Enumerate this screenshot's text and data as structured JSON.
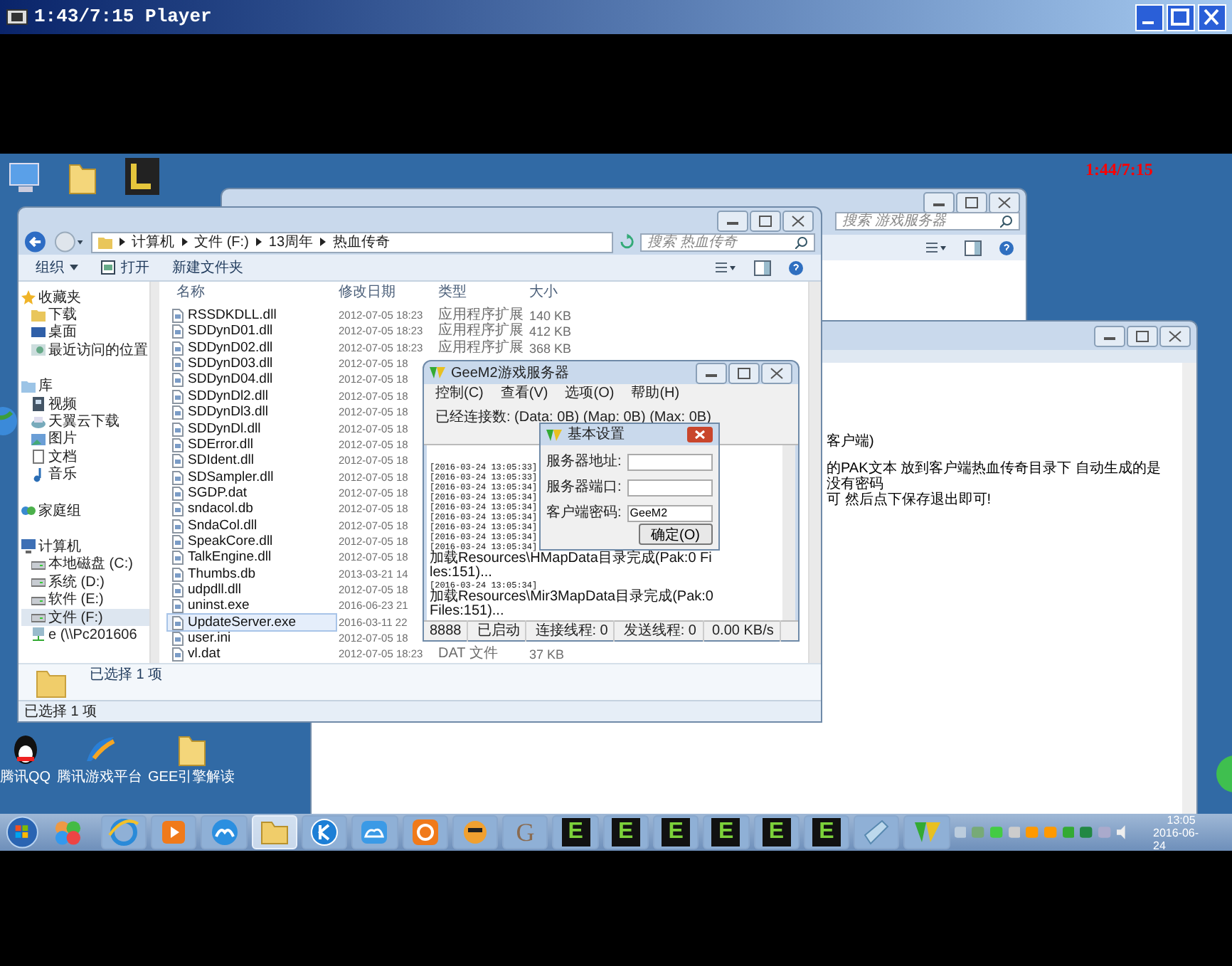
{
  "player": {
    "title": "1:43/7:15 Player"
  },
  "recording_time": "1:44/7:15",
  "desktop_icons": [
    {
      "label": "腾讯QQ"
    },
    {
      "label": "腾讯游戏平台"
    },
    {
      "label": "GEE引擎解读"
    }
  ],
  "back_window": {
    "search_placeholder": "搜索 游戏服务器"
  },
  "notepad": {
    "lines": [
      "客户端)",
      "的PAK文本 放到客户端热血传奇目录下   自动生成的是没有密码",
      "可 然后点下保存退出即可!"
    ]
  },
  "explorer": {
    "breadcrumb": [
      "计算机",
      "文件 (F:)",
      "13周年",
      "热血传奇"
    ],
    "search_placeholder": "搜索 热血传奇",
    "toolbar": [
      "组织",
      "打开",
      "新建文件夹"
    ],
    "sidebar": [
      {
        "label": "收藏夹",
        "kind": "star",
        "selected": false,
        "children": [
          {
            "label": "下载",
            "kind": "folder",
            "selected": false
          },
          {
            "label": "桌面",
            "kind": "desktop",
            "selected": false
          },
          {
            "label": "最近访问的位置",
            "kind": "recent",
            "selected": false
          }
        ]
      },
      {
        "label": "库",
        "kind": "library",
        "selected": false,
        "children": [
          {
            "label": "视频",
            "kind": "video",
            "selected": false
          },
          {
            "label": "天翼云下载",
            "kind": "cloud",
            "selected": false
          },
          {
            "label": "图片",
            "kind": "picture",
            "selected": false
          },
          {
            "label": "文档",
            "kind": "document",
            "selected": false
          },
          {
            "label": "音乐",
            "kind": "music",
            "selected": false
          }
        ]
      },
      {
        "label": "家庭组",
        "kind": "homegroup",
        "selected": false
      },
      {
        "label": "计算机",
        "kind": "computer",
        "selected": false,
        "children": [
          {
            "label": "本地磁盘 (C:)",
            "kind": "drive",
            "selected": false
          },
          {
            "label": "系统 (D:)",
            "kind": "drive",
            "selected": false
          },
          {
            "label": "软件 (E:)",
            "kind": "drive",
            "selected": false
          },
          {
            "label": "文件 (F:)",
            "kind": "drive",
            "selected": true
          },
          {
            "label": "e (\\\\Pc201606",
            "kind": "network",
            "selected": false
          }
        ]
      }
    ],
    "columns": [
      "名称",
      "修改日期",
      "类型",
      "大小"
    ],
    "rows": [
      {
        "name": "RSSDKDLL.dll",
        "date": "2012-07-05 18:23",
        "type": "应用程序扩展",
        "size": "140 KB",
        "selected": false
      },
      {
        "name": "SDDynD01.dll",
        "date": "2012-07-05 18:23",
        "type": "应用程序扩展",
        "size": "412 KB",
        "selected": false
      },
      {
        "name": "SDDynD02.dll",
        "date": "2012-07-05 18:23",
        "type": "应用程序扩展",
        "size": "368 KB",
        "selected": false
      },
      {
        "name": "SDDynD03.dll",
        "date": "2012-07-05 18",
        "selected": false
      },
      {
        "name": "SDDynD04.dll",
        "date": "2012-07-05 18",
        "selected": false
      },
      {
        "name": "SDDynDl2.dll",
        "date": "2012-07-05 18",
        "selected": false
      },
      {
        "name": "SDDynDl3.dll",
        "date": "2012-07-05 18",
        "selected": false
      },
      {
        "name": "SDDynDl.dll",
        "date": "2012-07-05 18",
        "selected": false
      },
      {
        "name": "SDError.dll",
        "date": "2012-07-05 18",
        "selected": false
      },
      {
        "name": "SDIdent.dll",
        "date": "2012-07-05 18",
        "selected": false
      },
      {
        "name": "SDSampler.dll",
        "date": "2012-07-05 18",
        "selected": false
      },
      {
        "name": "SGDP.dat",
        "date": "2012-07-05 18",
        "selected": false
      },
      {
        "name": "sndacol.db",
        "date": "2012-07-05 18",
        "selected": false
      },
      {
        "name": "SndaCol.dll",
        "date": "2012-07-05 18",
        "selected": false
      },
      {
        "name": "SpeakCore.dll",
        "date": "2012-07-05 18",
        "selected": false
      },
      {
        "name": "TalkEngine.dll",
        "date": "2012-07-05 18",
        "selected": false
      },
      {
        "name": "Thumbs.db",
        "date": "2013-03-21 14",
        "selected": false
      },
      {
        "name": "udpdll.dll",
        "date": "2012-07-05 18",
        "selected": false
      },
      {
        "name": "uninst.exe",
        "date": "2016-06-23 21",
        "selected": false
      },
      {
        "name": "UpdateServer.exe",
        "date": "2016-03-11 22",
        "selected": true
      },
      {
        "name": "user.ini",
        "date": "2012-07-05 18",
        "selected": false
      },
      {
        "name": "vl.dat",
        "date": "2012-07-05 18:23",
        "type": "DAT 文件",
        "size": "37 KB",
        "selected": false
      }
    ],
    "details": "已选择 1 项",
    "status": "已选择 1 项"
  },
  "server": {
    "title": "GeeM2游戏服务器",
    "menu": [
      "控制(C)",
      "查看(V)",
      "选项(O)",
      "帮助(H)"
    ],
    "info": "已经连接数: (Data: 0B) (Map: 0B) (Max: 0B)",
    "log": [
      {
        "time": "[2016-03-24 13:05:33]"
      },
      {
        "time": "[2016-03-24 13:05:33]"
      },
      {
        "time": "[2016-03-24 13:05:34]"
      },
      {
        "time": "[2016-03-24 13:05:34]"
      },
      {
        "time": "[2016-03-24 13:05:34]"
      },
      {
        "time": "[2016-03-24 13:05:34]"
      },
      {
        "time": "[2016-03-24 13:05:34]"
      },
      {
        "time": "[2016-03-24 13:05:34]"
      },
      {
        "time": "[2016-03-24 13:05:34]",
        "message": "加载Resources\\HMapData目录完成(Pak:0 Files:151)..."
      },
      {
        "time": "[2016-03-24 13:05:34]",
        "message": "加载Resources\\Mir3MapData目录完成(Pak:0 Files:151)..."
      }
    ],
    "status": [
      "8888",
      "已启动",
      "连接线程: 0",
      "发送线程: 0",
      "0.00 KB/s"
    ],
    "dialog": {
      "title": "基本设置",
      "fields": [
        {
          "label": "服务器地址:"
        },
        {
          "label": "服务器端口:"
        },
        {
          "label": "客户端密码:",
          "value": "GeeM2"
        }
      ],
      "button": "确定(O)"
    }
  },
  "taskbar": {
    "items": [
      {
        "kind": "ie"
      },
      {
        "kind": "player"
      },
      {
        "kind": "cloud"
      },
      {
        "kind": "folder",
        "selected": true
      },
      {
        "kind": "k"
      },
      {
        "kind": "cloud2"
      },
      {
        "kind": "browser"
      },
      {
        "kind": "game"
      },
      {
        "kind": "letter",
        "text": "G"
      },
      {
        "kind": "e",
        "text": "E"
      },
      {
        "kind": "e",
        "text": "E"
      },
      {
        "kind": "e",
        "text": "E"
      },
      {
        "kind": "e",
        "text": "E"
      },
      {
        "kind": "e",
        "text": "E"
      },
      {
        "kind": "e",
        "text": "E"
      },
      {
        "kind": "notepad"
      },
      {
        "kind": "server"
      }
    ],
    "time": "13:05",
    "date": "2016-06-24"
  }
}
